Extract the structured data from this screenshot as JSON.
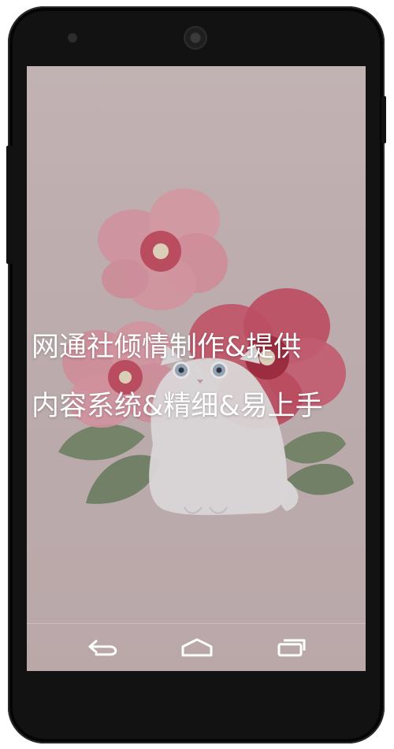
{
  "screen": {
    "slogan_line1": "网通社倾情制作&提供",
    "slogan_line2": "内容系统&精细&易上手"
  },
  "navigation_bar": {
    "back_icon": "back-icon",
    "home_icon": "home-icon",
    "recents_icon": "recents-icon"
  },
  "colors": {
    "wallpaper": "#d0bfc1",
    "flower_pink": "#e7a0ae",
    "flower_red": "#c9485e",
    "leaf_green": "#6f8a62",
    "cat_white": "#f1eef0",
    "text": "#ffffff"
  }
}
